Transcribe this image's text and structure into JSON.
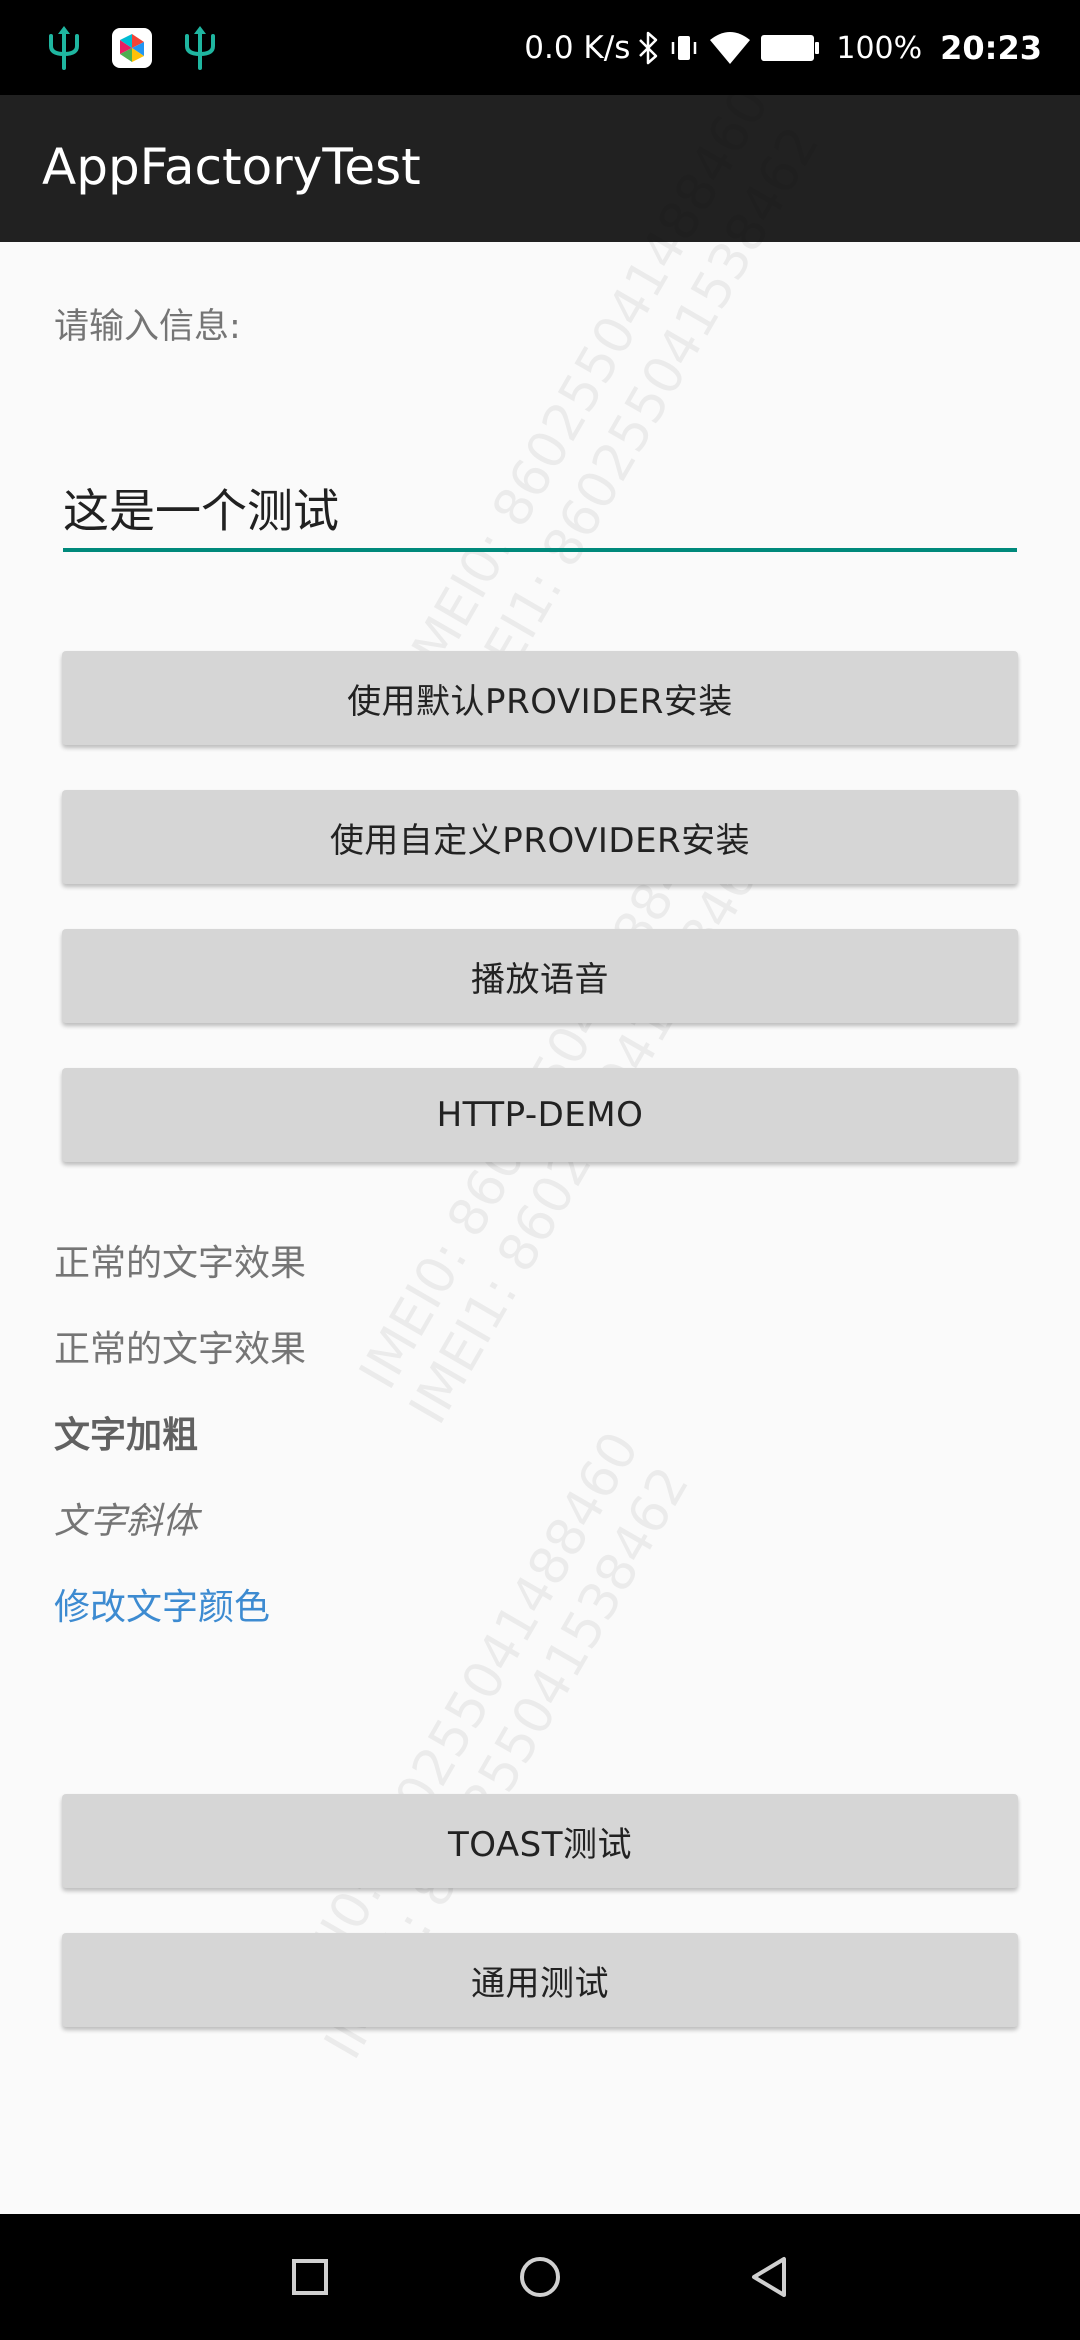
{
  "status_bar": {
    "net_speed": "0.0 K/s",
    "battery_percent": "100%",
    "time": "20:23",
    "icons": [
      "usb-icon",
      "app-notification-icon",
      "usb-icon",
      "bluetooth-icon",
      "vibrate-icon",
      "wifi-icon",
      "battery-icon"
    ]
  },
  "toolbar": {
    "title": "AppFactoryTest"
  },
  "form": {
    "prompt_label": "请输入信息:",
    "input_value": "这是一个测试"
  },
  "buttons": {
    "default_provider": "使用默认PROVIDER安装",
    "custom_provider": "使用自定义PROVIDER安装",
    "play_voice": "播放语音",
    "http_demo": "HTTP-DEMO",
    "toast_test": "TOAST测试",
    "general_test": "通用测试"
  },
  "text_styles": {
    "normal_1": "正常的文字效果",
    "normal_2": "正常的文字效果",
    "bold": "文字加粗",
    "italic": "文字斜体",
    "colored": "修改文字颜色",
    "colored_color": "#3d8bd1"
  },
  "watermarks": [
    "IMEI0: 860255041488460",
    "IMEI1: 860255041538462"
  ],
  "nav_bar": {
    "icons": [
      "recents-icon",
      "home-icon",
      "back-icon"
    ]
  },
  "colors": {
    "accent": "#00897b",
    "toolbar": "#212121",
    "button": "#d6d6d6"
  }
}
